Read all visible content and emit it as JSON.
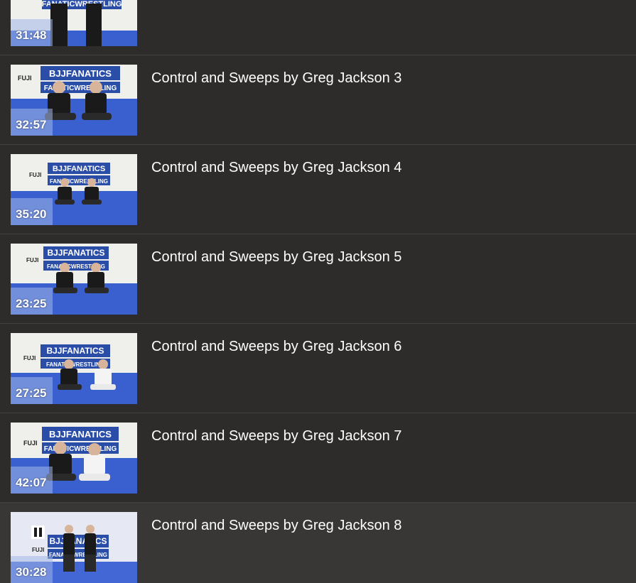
{
  "playlist": {
    "items": [
      {
        "duration": "31:48",
        "title": "",
        "thumb_variant": "standing"
      },
      {
        "duration": "32:57",
        "title": "Control and Sweeps by Greg Jackson 3",
        "thumb_variant": "seated-close"
      },
      {
        "duration": "35:20",
        "title": "Control and Sweeps by Greg Jackson 4",
        "thumb_variant": "seated-far"
      },
      {
        "duration": "23:25",
        "title": "Control and Sweeps by Greg Jackson 5",
        "thumb_variant": "seated-far"
      },
      {
        "duration": "27:25",
        "title": "Control and Sweeps by Greg Jackson 6",
        "thumb_variant": "seated-white"
      },
      {
        "duration": "42:07",
        "title": "Control and Sweeps by Greg Jackson 7",
        "thumb_variant": "seated-close-white"
      },
      {
        "duration": "30:28",
        "title": "Control and Sweeps by Greg Jackson 8",
        "thumb_variant": "standing-playing",
        "active": true
      }
    ]
  },
  "thumbnail_banner": {
    "brand_top": "BJJFANATICS",
    "brand_bottom": "FANATICWRESTLING",
    "sponsor": "FUJI"
  },
  "colors": {
    "background": "#2e2c2b",
    "active_background": "#383736",
    "divider": "#434140",
    "mat_blue": "#3a5fcf",
    "banner_blue": "#2a4ea8"
  },
  "icons": {
    "playing_indicator": "pause-icon"
  }
}
